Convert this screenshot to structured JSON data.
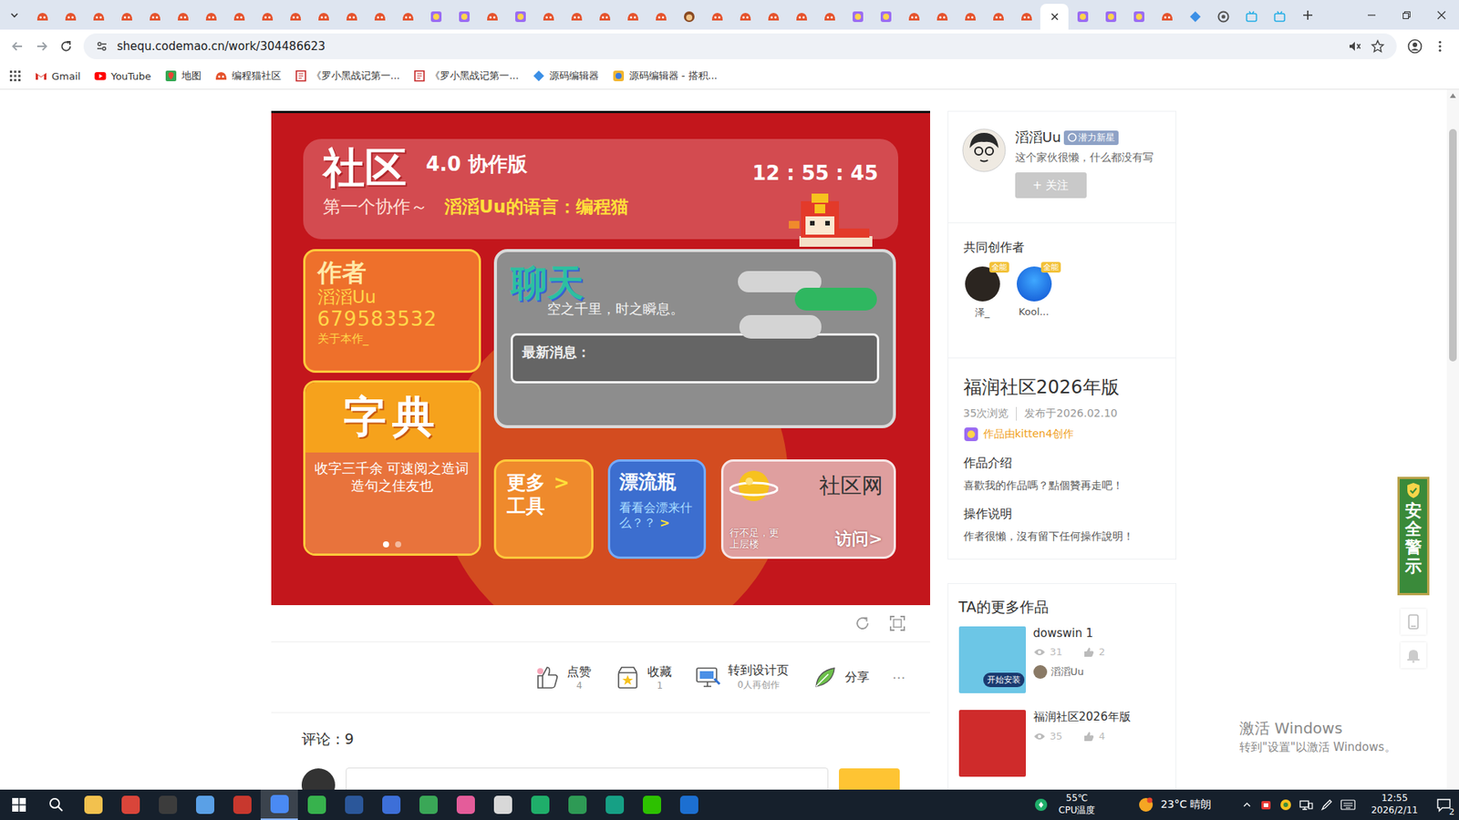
{
  "browser": {
    "tabs": [
      {
        "kind": "codemao",
        "selected": false
      },
      {
        "kind": "codemao",
        "selected": false
      },
      {
        "kind": "codemao",
        "selected": false
      },
      {
        "kind": "codemao",
        "selected": false
      },
      {
        "kind": "codemao",
        "selected": false
      },
      {
        "kind": "codemao",
        "selected": false
      },
      {
        "kind": "codemao",
        "selected": false
      },
      {
        "kind": "codemao",
        "selected": false
      },
      {
        "kind": "codemao",
        "selected": false
      },
      {
        "kind": "codemao",
        "selected": false
      },
      {
        "kind": "codemao",
        "selected": false
      },
      {
        "kind": "codemao",
        "selected": false
      },
      {
        "kind": "codemao",
        "selected": false
      },
      {
        "kind": "codemao",
        "selected": false
      },
      {
        "kind": "kitten",
        "selected": false
      },
      {
        "kind": "kitten",
        "selected": false
      },
      {
        "kind": "codemao",
        "selected": false
      },
      {
        "kind": "kitten",
        "selected": false
      },
      {
        "kind": "codemao",
        "selected": false
      },
      {
        "kind": "codemao",
        "selected": false
      },
      {
        "kind": "codemao",
        "selected": false
      },
      {
        "kind": "codemao",
        "selected": false
      },
      {
        "kind": "codemao",
        "selected": false
      },
      {
        "kind": "cat",
        "selected": false
      },
      {
        "kind": "codemao",
        "selected": false
      },
      {
        "kind": "codemao",
        "selected": false
      },
      {
        "kind": "codemao",
        "selected": false
      },
      {
        "kind": "codemao",
        "selected": false
      },
      {
        "kind": "codemao",
        "selected": false
      },
      {
        "kind": "kitten",
        "selected": false
      },
      {
        "kind": "kitten",
        "selected": false
      },
      {
        "kind": "codemao",
        "selected": false
      },
      {
        "kind": "codemao",
        "selected": false
      },
      {
        "kind": "codemao",
        "selected": false
      },
      {
        "kind": "codemao",
        "selected": false
      },
      {
        "kind": "codemao",
        "selected": false
      },
      {
        "kind": "codemao",
        "selected": true
      },
      {
        "kind": "kitten",
        "selected": false
      },
      {
        "kind": "kitten",
        "selected": false
      },
      {
        "kind": "kitten",
        "selected": false
      },
      {
        "kind": "codemao",
        "selected": false
      },
      {
        "kind": "diamond",
        "selected": false
      },
      {
        "kind": "chrome",
        "selected": false
      },
      {
        "kind": "bilibili",
        "selected": false
      },
      {
        "kind": "bilibili",
        "selected": false
      }
    ],
    "url": "shequ.codemao.cn/work/304486623",
    "bookmarks": [
      {
        "label": "Gmail",
        "kind": "gmail"
      },
      {
        "label": "YouTube",
        "kind": "youtube"
      },
      {
        "label": "地图",
        "kind": "maps"
      },
      {
        "label": "编程猫社区",
        "kind": "codemao"
      },
      {
        "label": "《罗小黑战记第一...",
        "kind": "doc"
      },
      {
        "label": "《罗小黑战记第一...",
        "kind": "doc"
      },
      {
        "label": "源码编辑器",
        "kind": "diamond"
      },
      {
        "label": "源码编辑器 - 搭积...",
        "kind": "kitten"
      }
    ]
  },
  "stage": {
    "header": {
      "title": "社区",
      "edition": "4.0 协作版",
      "clock": "12 : 55 : 45",
      "subtitle": "第一个协作～",
      "language": "滔滔Uu的语言：编程猫"
    },
    "author_card": {
      "title": "作者",
      "name": "滔滔Uu",
      "id": "679583532",
      "about": "关于本作_"
    },
    "chat": {
      "title": "聊天",
      "motto": "空之千里，时之瞬息。",
      "latest": "最新消息："
    },
    "dictionary": {
      "title": "字典",
      "desc": "收字三千余 可速阅之造词造句之佳友也",
      "dots": [
        {
          "selected": true
        },
        {
          "selected": false
        }
      ]
    },
    "tools": {
      "line1": "更多",
      "arrow": ">",
      "line2": "工具"
    },
    "bottle": {
      "title": "漂流瓶",
      "desc": "看看会漂来什么？？",
      "arrow": ">"
    },
    "site": {
      "title": "社区网",
      "tagline": "行不足，更上层楼",
      "visit": "访问>"
    }
  },
  "actions": [
    {
      "label": "点赞",
      "count": "4",
      "kind": "like"
    },
    {
      "label": "收藏",
      "count": "1",
      "kind": "collect"
    },
    {
      "label": "转到设计页",
      "count": "0人再创作",
      "kind": "design"
    },
    {
      "label": "分享",
      "count": "",
      "kind": "share"
    }
  ],
  "more_label": "···",
  "comments": {
    "title": "评论：9"
  },
  "author": {
    "name": "滔滔Uu",
    "badge": "潜力新星",
    "bio": "这个家伙很懒，什么都没有写",
    "follow": "+ 关注"
  },
  "coauthors": {
    "title": "共同创作者",
    "items": [
      {
        "name": "泽_",
        "badge": "全能"
      },
      {
        "name": "Kool...",
        "badge": "全能"
      }
    ]
  },
  "work": {
    "title": "福润社区2026年版",
    "views": "35次浏览",
    "published": "发布于2026.02.10",
    "made_with": "作品由kitten4创作",
    "intro_title": "作品介绍",
    "intro": "喜歡我的作品嗎？點個贊再走吧！",
    "howto_title": "操作说明",
    "howto": "作者很懶，沒有留下任何操作說明！"
  },
  "more_works": {
    "title": "TA的更多作品",
    "items": [
      {
        "title": "dowswin 1",
        "views": "31",
        "likes": "2",
        "author": "滔滔Uu",
        "thumb_label": "开始安装",
        "color": "#6cc6e6"
      },
      {
        "title": "福润社区2026年版",
        "views": "35",
        "likes": "4",
        "color": "#cf2b2b"
      }
    ]
  },
  "safety": "安全警示",
  "watermark": {
    "title": "激活 Windows",
    "hint": "转到\"设置\"以激活 Windows。"
  },
  "taskbar": {
    "apps": [
      {
        "color": "#f2c14e",
        "selected": false
      },
      {
        "color": "#d9453a",
        "selected": false
      },
      {
        "color": "#3c3c3c",
        "selected": false
      },
      {
        "color": "#5aa0e6",
        "selected": false
      },
      {
        "color": "#c8382e",
        "selected": false
      },
      {
        "color": "#4a8af4",
        "selected": true
      },
      {
        "color": "#37b24d",
        "selected": false
      },
      {
        "color": "#2b579a",
        "selected": false
      },
      {
        "color": "#3d6fd8",
        "selected": false
      },
      {
        "color": "#3aa757",
        "selected": false
      },
      {
        "color": "#e45c9a",
        "selected": false
      },
      {
        "color": "#d8d8d8",
        "selected": false
      },
      {
        "color": "#1fae6a",
        "selected": false
      },
      {
        "color": "#2e9a55",
        "selected": false
      },
      {
        "color": "#16a085",
        "selected": false
      },
      {
        "color": "#2dc100",
        "selected": false
      },
      {
        "color": "#1c6fd1",
        "selected": false
      }
    ],
    "cpu_temp": "55℃",
    "cpu_label": "CPU温度",
    "weather": "23°C 晴朗",
    "time": "12:55",
    "date": "2026/2/11",
    "notifications": "2"
  }
}
